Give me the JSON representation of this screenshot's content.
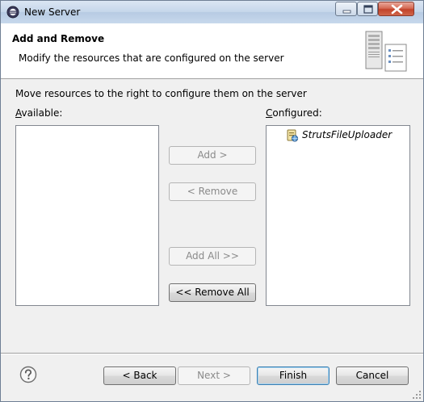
{
  "window": {
    "title": "New Server"
  },
  "header": {
    "title": "Add and Remove",
    "description": "Modify the resources that are configured on the server"
  },
  "main": {
    "instructions": "Move resources to the right to configure them on the server",
    "available": {
      "label": "Available:",
      "items": []
    },
    "configured": {
      "label": "Configured:",
      "items": [
        {
          "label": "StrutsFileUploader",
          "icon": "web-module-icon"
        }
      ]
    },
    "buttons": {
      "add": "Add >",
      "remove": "< Remove",
      "add_all": "Add All >>",
      "remove_all": "<< Remove All"
    }
  },
  "footer": {
    "help_icon": "help-icon",
    "back": "< Back",
    "next": "Next >",
    "finish": "Finish",
    "cancel": "Cancel"
  },
  "colors": {
    "header_bg": "#ffffff",
    "dialog_bg": "#f0f0f0",
    "title_bar": "#c5d6ea",
    "close_button": "#c2432a"
  }
}
